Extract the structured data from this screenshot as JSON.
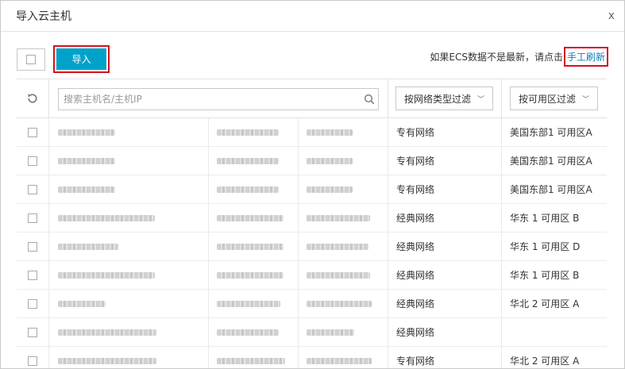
{
  "dialog": {
    "title": "导入云主机",
    "close_label": "x"
  },
  "toolbar": {
    "import_label": "导入",
    "refresh_hint": "如果ECS数据不是最新，请点击",
    "refresh_link": "手工刷新"
  },
  "search": {
    "placeholder": "搜索主机名/主机IP"
  },
  "filters": {
    "network_type_label": "按网络类型过滤",
    "zone_label": "按可用区过滤"
  },
  "rows": [
    {
      "network": "专有网络",
      "zone": "美国东部1 可用区A"
    },
    {
      "network": "专有网络",
      "zone": "美国东部1 可用区A"
    },
    {
      "network": "专有网络",
      "zone": "美国东部1 可用区A"
    },
    {
      "network": "经典网络",
      "zone": "华东 1 可用区 B"
    },
    {
      "network": "经典网络",
      "zone": "华东 1 可用区 D"
    },
    {
      "network": "经典网络",
      "zone": "华东 1 可用区 B"
    },
    {
      "network": "经典网络",
      "zone": "华北 2 可用区 A"
    },
    {
      "network": "经典网络",
      "zone": ""
    },
    {
      "network": "专有网络",
      "zone": "华北 2 可用区 A"
    }
  ]
}
